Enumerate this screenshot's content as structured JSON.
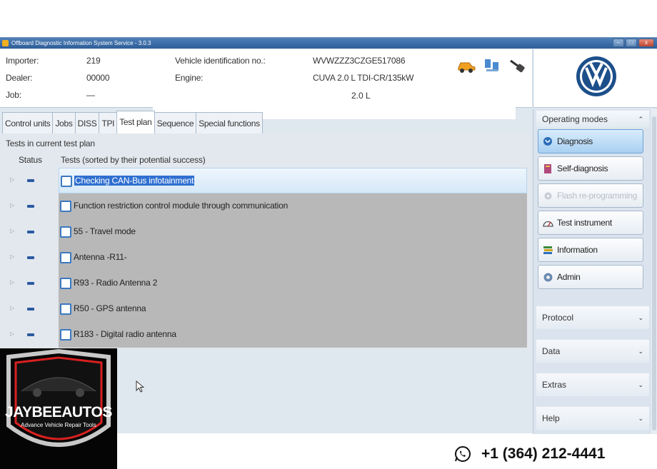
{
  "window": {
    "title": "Offboard Diagnostic Information System Service - 3.0.3",
    "buttons": [
      "–",
      "□",
      "x"
    ]
  },
  "header": {
    "importer_label": "Importer:",
    "importer_value": "219",
    "dealer_label": "Dealer:",
    "dealer_value": "00000",
    "job_label": "Job:",
    "job_value": "—",
    "vin_label": "Vehicle identification no.:",
    "vin_value": "WVWZZZ3CZGE517086",
    "engine_label": "Engine:",
    "engine_value": "CUVA 2.0 L TDI-CR/135kW",
    "engine_extra": "2.0 L"
  },
  "tabs": [
    {
      "label": "Control units"
    },
    {
      "label": "Jobs"
    },
    {
      "label": "DISS"
    },
    {
      "label": "TPI"
    },
    {
      "label": "Test plan",
      "active": true
    },
    {
      "label": "Sequence"
    },
    {
      "label": "Special functions"
    }
  ],
  "test_plan": {
    "section_label": "Tests in current test plan",
    "col_status": "Status",
    "col_tests": "Tests (sorted by their potential success)",
    "rows": [
      {
        "label": "Checking CAN-Bus infotainment",
        "selected": true
      },
      {
        "label": "Function restriction control module through communication"
      },
      {
        "label": "55 - Travel mode"
      },
      {
        "label": "Antenna -R11-"
      },
      {
        "label": "R93 - Radio Antenna 2"
      },
      {
        "label": "R50 - GPS antenna"
      },
      {
        "label": "R183 - Digital radio antenna"
      }
    ]
  },
  "sidebar": {
    "operating_modes": "Operating modes",
    "buttons": [
      {
        "label": "Diagnosis",
        "icon": "stethoscope-icon",
        "state": "active"
      },
      {
        "label": "Self-diagnosis",
        "icon": "book-icon",
        "state": "normal"
      },
      {
        "label": "Flash re-programming",
        "icon": "gear-icon",
        "state": "disabled"
      },
      {
        "label": "Test instrument",
        "icon": "gauge-icon",
        "state": "normal"
      },
      {
        "label": "Information",
        "icon": "books-icon",
        "state": "normal"
      },
      {
        "label": "Admin",
        "icon": "admin-gear-icon",
        "state": "normal"
      }
    ],
    "sections": [
      "Protocol",
      "Data",
      "Extras",
      "Help"
    ]
  },
  "brand": {
    "name": "JAYBEEAUTOS",
    "tagline": "Advance Vehicle Repair Tools"
  },
  "contact": {
    "phone": "+1 (364) 212-4441",
    "icon": "whatsapp-icon"
  },
  "colors": {
    "selection": "#2f6fd0",
    "active_mode": "#a9d0f3",
    "row_gray": "#b8b8b8"
  }
}
